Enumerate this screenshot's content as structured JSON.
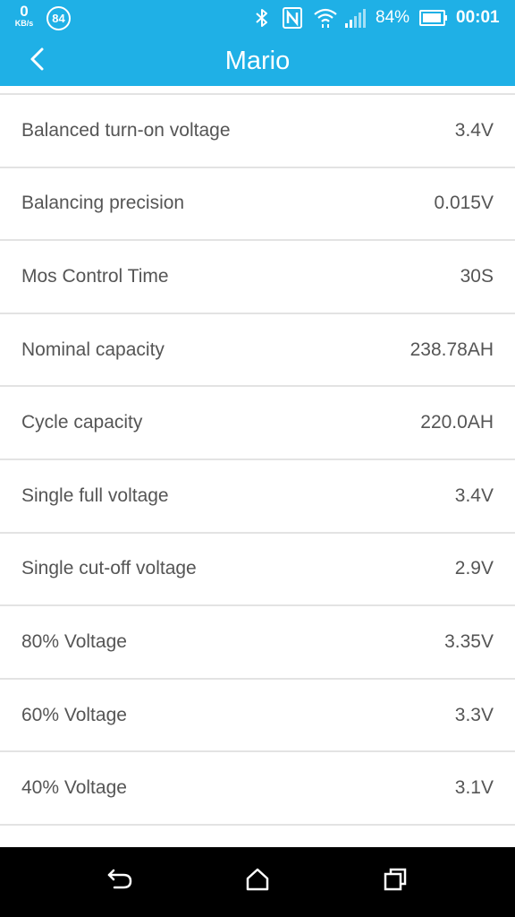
{
  "status_bar": {
    "net_speed_value": "0",
    "net_speed_unit": "KB/s",
    "notification_count": "84",
    "battery_percent": "84%",
    "time": "00:01"
  },
  "app_bar": {
    "title": "Mario"
  },
  "settings": [
    {
      "label": "Balanced turn-on voltage",
      "value": "3.4V"
    },
    {
      "label": "Balancing precision",
      "value": "0.015V"
    },
    {
      "label": "Mos Control Time",
      "value": "30S"
    },
    {
      "label": "Nominal capacity",
      "value": "238.78AH"
    },
    {
      "label": "Cycle capacity",
      "value": "220.0AH"
    },
    {
      "label": "Single full voltage",
      "value": "3.4V"
    },
    {
      "label": "Single cut-off voltage",
      "value": "2.9V"
    },
    {
      "label": "80% Voltage",
      "value": "3.35V"
    },
    {
      "label": "60% Voltage",
      "value": "3.3V"
    },
    {
      "label": "40% Voltage",
      "value": "3.1V"
    }
  ],
  "icons": {
    "status": [
      "bluetooth-icon",
      "nfc-icon",
      "wifi-icon",
      "signal-icon",
      "battery-icon"
    ],
    "nav": [
      "back-icon",
      "home-icon",
      "recents-icon"
    ]
  },
  "colors": {
    "accent": "#1fb0e6",
    "text": "#555555",
    "divider": "#e3e3e3",
    "nav_bar": "#000000"
  }
}
